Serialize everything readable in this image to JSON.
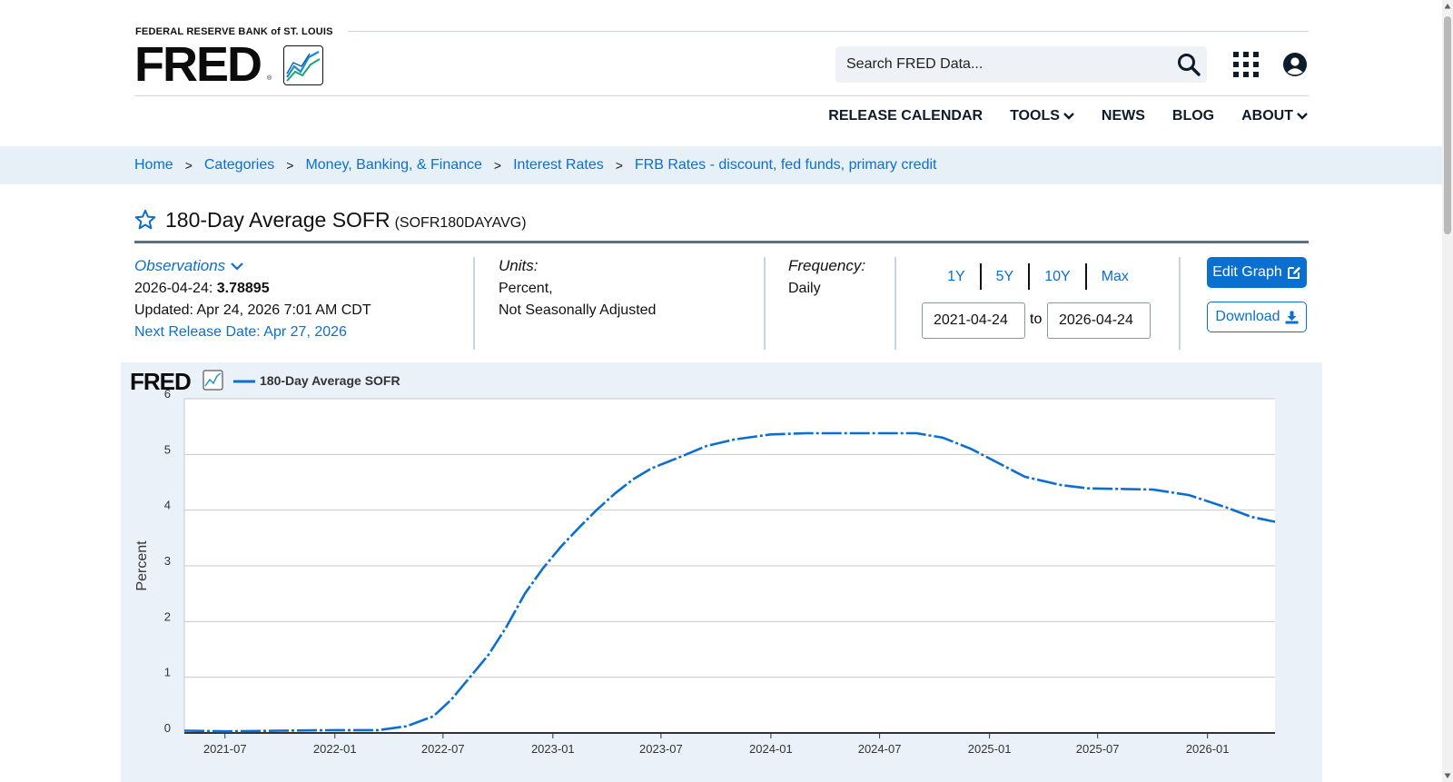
{
  "header": {
    "logo_subtitle": "FEDERAL RESERVE BANK of ST. LOUIS",
    "logo_word": "FRED",
    "logo_reg": "®",
    "search_placeholder": "Search FRED Data...",
    "nav": [
      {
        "label": "RELEASE CALENDAR",
        "dropdown": false
      },
      {
        "label": "TOOLS",
        "dropdown": true
      },
      {
        "label": "NEWS",
        "dropdown": false
      },
      {
        "label": "BLOG",
        "dropdown": false
      },
      {
        "label": "ABOUT",
        "dropdown": true
      }
    ]
  },
  "breadcrumb": {
    "items": [
      "Home",
      "Categories",
      "Money, Banking, & Finance",
      "Interest Rates",
      "FRB Rates - discount, fed funds, primary credit"
    ],
    "separator": ">"
  },
  "series": {
    "title": "180-Day Average SOFR",
    "id": "(SOFR180DAYAVG)"
  },
  "observations": {
    "toggle_label": "Observations",
    "date": "2026-04-24:",
    "value": "3.78895",
    "updated": "Updated: Apr 24, 2026 7:01 AM CDT",
    "next_release": "Next Release Date: Apr 27, 2026"
  },
  "units": {
    "label": "Units:",
    "line1": "Percent,",
    "line2": "Not Seasonally Adjusted"
  },
  "frequency": {
    "label": "Frequency:",
    "value": "Daily"
  },
  "range": {
    "buttons": [
      "1Y",
      "5Y",
      "10Y",
      "Max"
    ],
    "from": "2021-04-24",
    "to_label": "to",
    "to": "2026-04-24"
  },
  "actions": {
    "edit_label": "Edit Graph",
    "download_label": "Download"
  },
  "colors": {
    "accent": "#0b6fd0",
    "series_line": "#0b6fd0",
    "chart_bg": "#eaf1f8"
  },
  "chart_data": {
    "type": "line",
    "legend_logo": "FRED",
    "legend": "180-Day Average SOFR",
    "ylabel": "Percent",
    "ylim": [
      0,
      6
    ],
    "yticks": [
      0,
      1,
      2,
      3,
      4,
      5,
      6
    ],
    "xlim": [
      "2021-04-24",
      "2026-04-24"
    ],
    "xticks": [
      "2021-07",
      "2022-01",
      "2022-07",
      "2023-01",
      "2023-07",
      "2024-01",
      "2024-07",
      "2025-01",
      "2025-07",
      "2026-01"
    ],
    "grid": true,
    "series": [
      {
        "name": "180-Day Average SOFR",
        "points": [
          [
            "2021-04-24",
            0.04
          ],
          [
            "2021-07-01",
            0.03
          ],
          [
            "2021-10-01",
            0.04
          ],
          [
            "2022-01-01",
            0.05
          ],
          [
            "2022-03-15",
            0.05
          ],
          [
            "2022-05-01",
            0.12
          ],
          [
            "2022-06-15",
            0.3
          ],
          [
            "2022-07-15",
            0.6
          ],
          [
            "2022-08-15",
            1.0
          ],
          [
            "2022-09-15",
            1.4
          ],
          [
            "2022-10-15",
            1.9
          ],
          [
            "2022-11-15",
            2.5
          ],
          [
            "2022-12-15",
            2.95
          ],
          [
            "2023-01-15",
            3.35
          ],
          [
            "2023-02-15",
            3.7
          ],
          [
            "2023-03-15",
            4.0
          ],
          [
            "2023-04-15",
            4.3
          ],
          [
            "2023-05-15",
            4.55
          ],
          [
            "2023-06-15",
            4.75
          ],
          [
            "2023-08-01",
            4.95
          ],
          [
            "2023-09-15",
            5.15
          ],
          [
            "2023-11-01",
            5.27
          ],
          [
            "2024-01-01",
            5.36
          ],
          [
            "2024-03-01",
            5.38
          ],
          [
            "2024-05-01",
            5.38
          ],
          [
            "2024-07-01",
            5.38
          ],
          [
            "2024-09-01",
            5.38
          ],
          [
            "2024-10-15",
            5.3
          ],
          [
            "2024-12-01",
            5.1
          ],
          [
            "2025-01-15",
            4.85
          ],
          [
            "2025-03-01",
            4.6
          ],
          [
            "2025-05-01",
            4.45
          ],
          [
            "2025-06-15",
            4.39
          ],
          [
            "2025-08-15",
            4.38
          ],
          [
            "2025-10-01",
            4.37
          ],
          [
            "2025-12-01",
            4.27
          ],
          [
            "2026-02-01",
            4.05
          ],
          [
            "2026-03-15",
            3.88
          ],
          [
            "2026-04-24",
            3.79
          ]
        ]
      }
    ]
  }
}
